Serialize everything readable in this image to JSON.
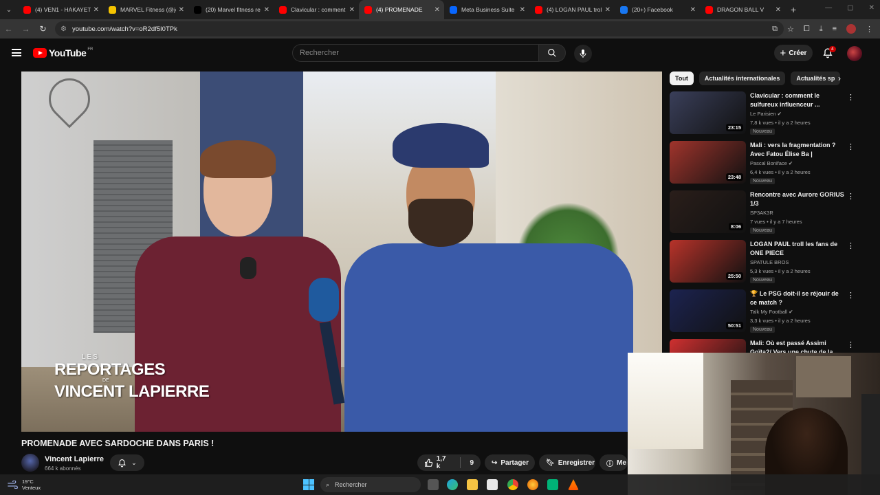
{
  "browser": {
    "tabs": [
      {
        "title": "(4) VEN1 - HAKAYET",
        "favicon_color": "#ff0000",
        "active": false
      },
      {
        "title": "MARVEL Fitness (@jo",
        "favicon_color": "#f5c400",
        "active": false
      },
      {
        "title": "(20) Marvel fitness re",
        "favicon_color": "#000000",
        "active": false
      },
      {
        "title": "Clavicular : comment",
        "favicon_color": "#ff0000",
        "active": false
      },
      {
        "title": "(4) PROMENADE",
        "favicon_color": "#ff0000",
        "active": true
      },
      {
        "title": "Meta Business Suite",
        "favicon_color": "#0866ff",
        "active": false
      },
      {
        "title": "(4) LOGAN PAUL trol",
        "favicon_color": "#ff0000",
        "active": false
      },
      {
        "title": "(20+) Facebook",
        "favicon_color": "#1877f2",
        "active": false
      },
      {
        "title": "DRAGON BALL V",
        "favicon_color": "#ff0000",
        "active": false
      }
    ],
    "url": "youtube.com/watch?v=oR2df5I0TPk"
  },
  "youtube": {
    "logo_text": "YouTube",
    "country_code": "FR",
    "search_placeholder": "Rechercher",
    "create_label": "Créer",
    "notification_count": "4"
  },
  "video": {
    "watermark_small": "LES",
    "watermark_line1": "REPORTAGES",
    "watermark_mid": "DE",
    "watermark_line2": "VINCENT LAPIERRE",
    "title": "PROMENADE AVEC SARDOCHE DANS PARIS !",
    "channel": "Vincent Lapierre",
    "subscribers": "664 k abonnés",
    "likes": "1,7 k",
    "comments": "9",
    "share_label": "Partager",
    "save_label": "Enregistrer",
    "more_label": "Me"
  },
  "chips": [
    "Tout",
    "Actualités internationales",
    "Actualités sp"
  ],
  "recommendations": [
    {
      "title": "Clavicular : comment le sulfureux influenceur ...",
      "channel": "Le Parisien",
      "verified": true,
      "meta": "7,8 k vues • il y a 2 heures",
      "badge": "Nouveau",
      "duration": "23:15",
      "thumb_color": "#3a3f5a"
    },
    {
      "title": "Mali : vers la fragmentation ? Avec Fatou Élise Ba | Entretien...",
      "channel": "Pascal Boniface",
      "verified": true,
      "meta": "6,4 k vues • il y a 2 heures",
      "badge": "Nouveau",
      "duration": "23:48",
      "thumb_color": "#a0342c"
    },
    {
      "title": "Rencontre avec Aurore GORIUS 1/3",
      "channel": "SP3AK3R",
      "verified": false,
      "meta": "7 vues • il y a 7 heures",
      "badge": "Nouveau",
      "duration": "8:06",
      "thumb_color": "#2a1e1a"
    },
    {
      "title": "LOGAN PAUL troll les fans de ONE PIECE",
      "channel": "SPATULE BROS",
      "verified": false,
      "meta": "5,3 k vues • il y a 2 heures",
      "badge": "Nouveau",
      "duration": "25:50",
      "thumb_color": "#b8332a"
    },
    {
      "title": "🏆 Le PSG doit-il se réjouir de ce match ?",
      "channel": "Talk My Football",
      "verified": true,
      "meta": "3,3 k vues • il y a 2 heures",
      "badge": "Nouveau",
      "duration": "50:51",
      "thumb_color": "#1c2350"
    },
    {
      "title": "Mali: Où est passé Assimi Goïta?/ Vers une chute de la",
      "channel": "",
      "verified": false,
      "meta": "",
      "badge": "",
      "duration": "",
      "thumb_color": "#d03030"
    }
  ],
  "taskbar": {
    "temperature": "19°C",
    "weather": "Venteux",
    "search_label": "Rechercher"
  }
}
